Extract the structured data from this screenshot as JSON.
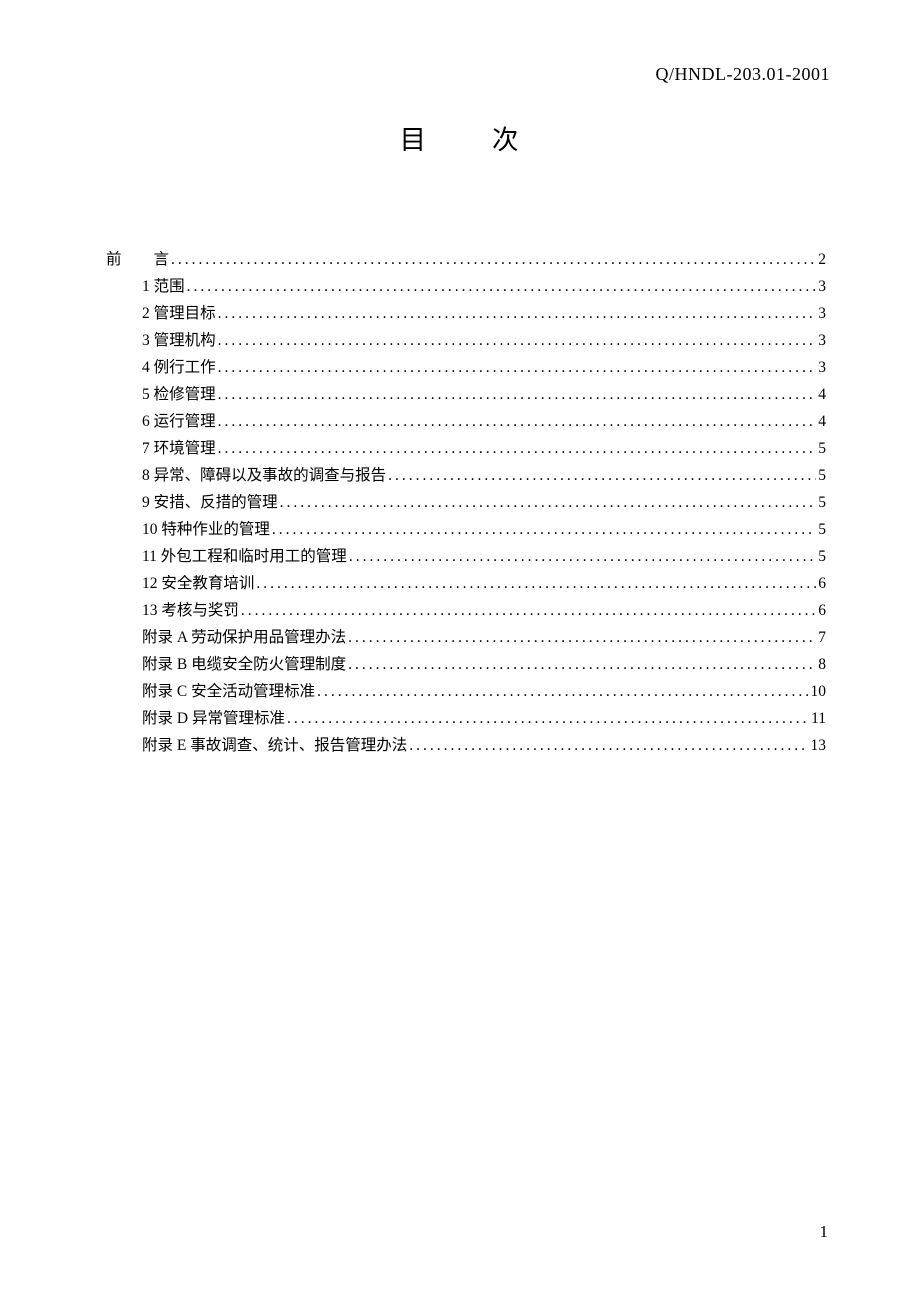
{
  "header_code": "Q/HNDL-203.01-2001",
  "title_a": "目",
  "title_b": "次",
  "preface_prefix": "前",
  "preface_label": "言",
  "preface_page": "2",
  "toc": [
    {
      "label": "1 范围",
      "page": "3"
    },
    {
      "label": "2 管理目标",
      "page": "3"
    },
    {
      "label": "3 管理机构",
      "page": "3"
    },
    {
      "label": "4 例行工作",
      "page": "3"
    },
    {
      "label": "5 检修管理",
      "page": "4"
    },
    {
      "label": "6 运行管理",
      "page": "4"
    },
    {
      "label": "7 环境管理",
      "page": "5"
    },
    {
      "label": "8 异常、障碍以及事故的调查与报告",
      "page": "5"
    },
    {
      "label": "9 安措、反措的管理",
      "page": "5"
    },
    {
      "label": "10 特种作业的管理",
      "page": "5"
    },
    {
      "label": "11 外包工程和临时用工的管理",
      "page": "5"
    },
    {
      "label": "12 安全教育培训",
      "page": "6"
    },
    {
      "label": "13 考核与奖罚",
      "page": "6"
    },
    {
      "label": "附录 A  劳动保护用品管理办法",
      "page": "7"
    },
    {
      "label": "附录 B  电缆安全防火管理制度",
      "page": "8"
    },
    {
      "label": "附录 C  安全活动管理标准",
      "page": "10"
    },
    {
      "label": "附录 D  异常管理标准",
      "page": "11"
    },
    {
      "label": "附录 E  事故调查、统计、报告管理办法",
      "page": "13"
    }
  ],
  "page_number": "1"
}
